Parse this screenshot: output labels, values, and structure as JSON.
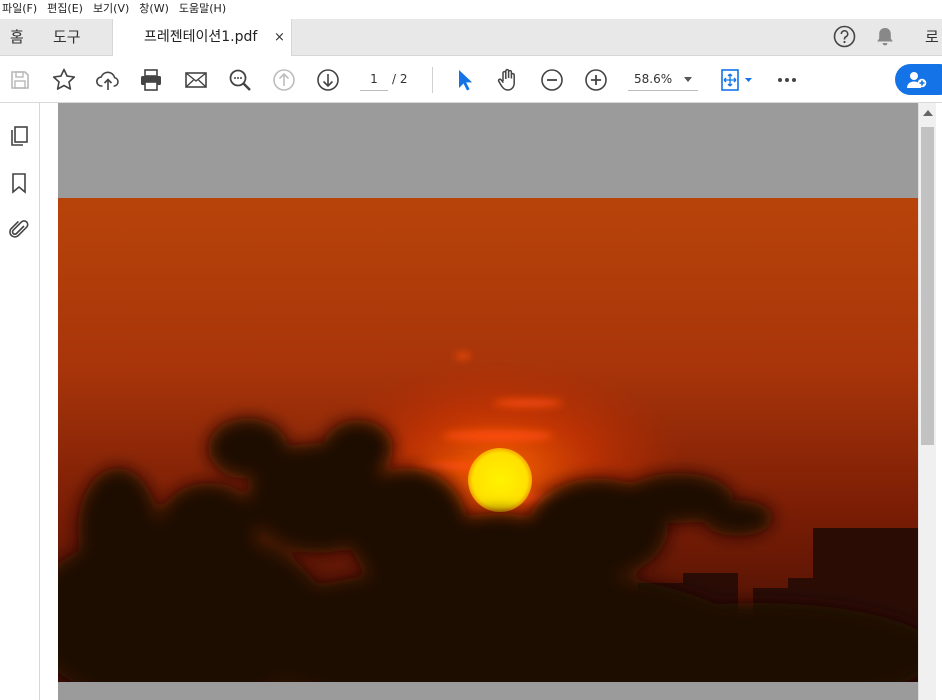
{
  "menu": [
    "파일(F)",
    "편집(E)",
    "보기(V)",
    "창(W)",
    "도움말(H)"
  ],
  "tabs": {
    "home": "홈",
    "tools": "도구",
    "document": "프레젠테이션1.pdf",
    "close_glyph": "×",
    "login": "로"
  },
  "toolbar": {
    "current_page": "1",
    "page_separator": "/ 2",
    "zoom": "58.6%",
    "icons": [
      "save-icon",
      "star-icon",
      "cloud-upload-icon",
      "print-icon",
      "mail-icon",
      "search-icon",
      "page-up-icon",
      "page-down-icon",
      "select-cursor-icon",
      "hand-icon",
      "zoom-out-icon",
      "zoom-in-icon",
      "fit-page-icon",
      "more-icon"
    ]
  },
  "colors": {
    "accent": "#1473e6",
    "sky_top": "#b5400a",
    "sky_mid": "#8a2005",
    "sun": "#ffe600"
  }
}
